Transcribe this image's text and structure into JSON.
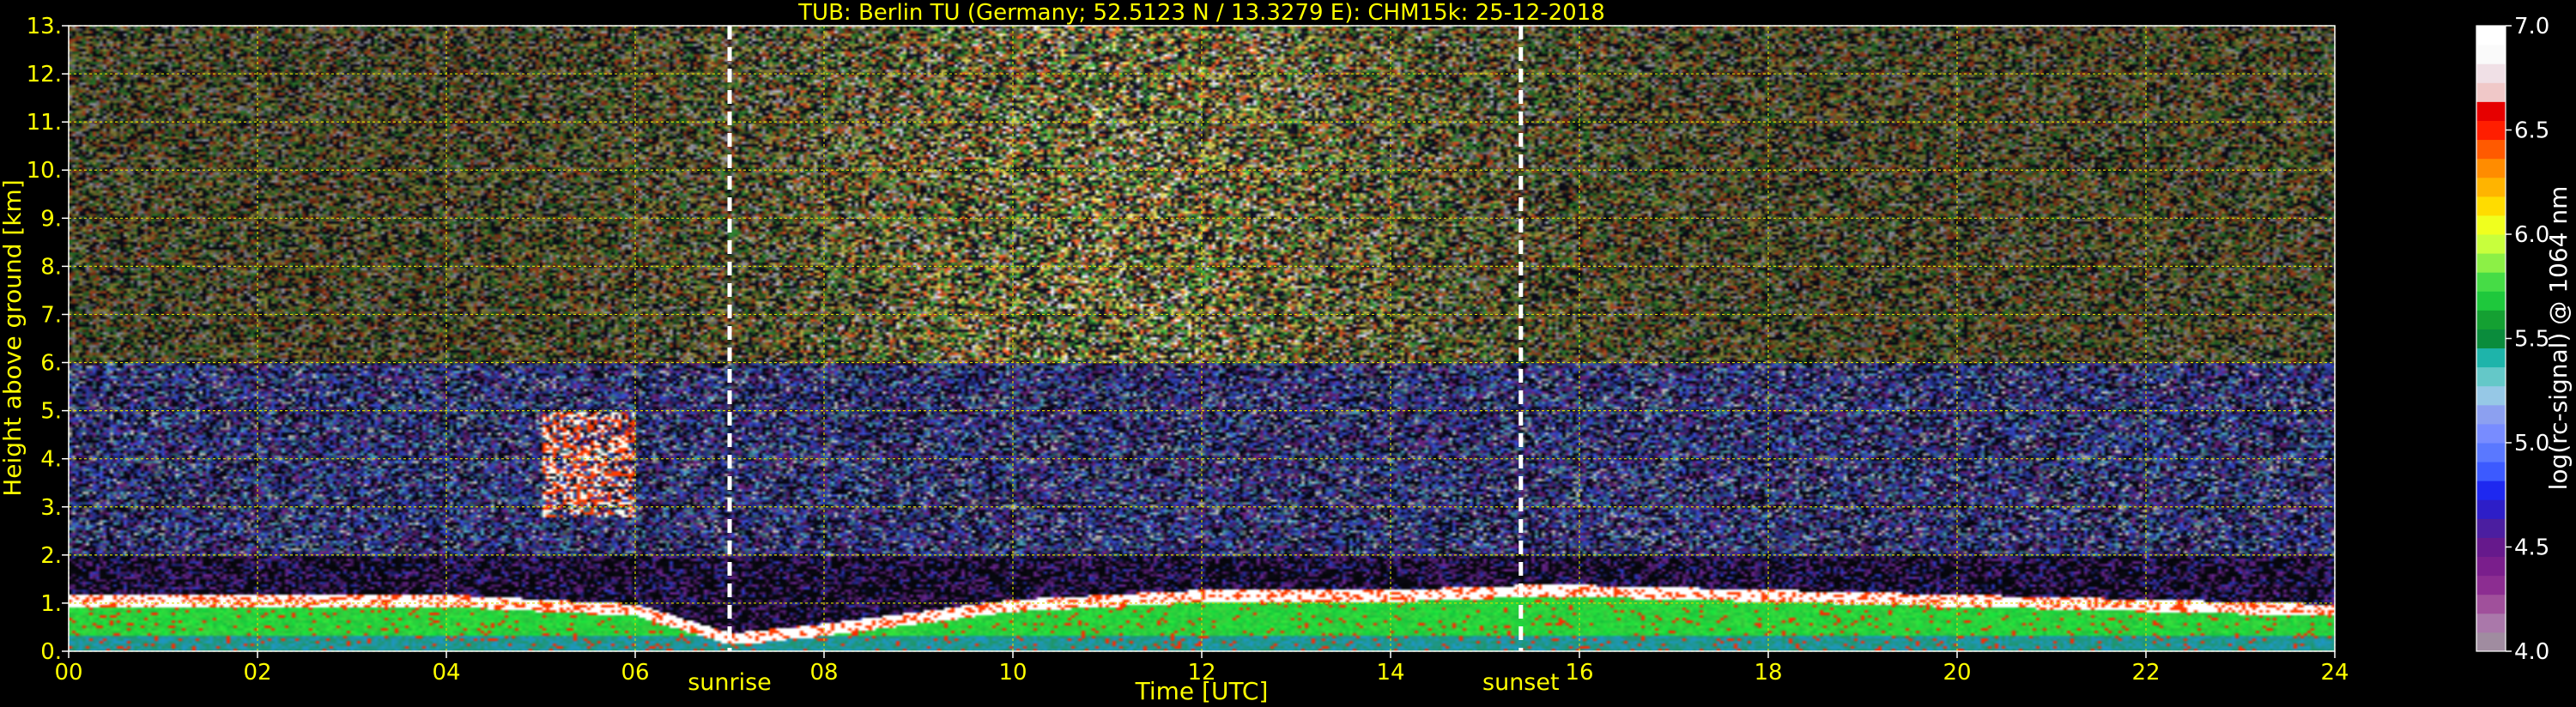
{
  "chart_data": [
    {
      "type": "heatmap",
      "title": "TUB: Berlin TU (Germany; 52.5123 N / 13.3279 E):    CHM15k: 25-12-2018",
      "xlabel": "Time [UTC]",
      "ylabel": "Height above ground [km]",
      "xlim": [
        0,
        24
      ],
      "ylim": [
        0,
        13
      ],
      "x_ticks": [
        "00",
        "02",
        "04",
        "06",
        "08",
        "10",
        "12",
        "14",
        "16",
        "18",
        "20",
        "22",
        "24"
      ],
      "y_ticks": [
        "0.",
        "1.",
        "2.",
        "3.",
        "4.",
        "5.",
        "6.",
        "7.",
        "8.",
        "9.",
        "10.",
        "11.",
        "12.",
        "13."
      ],
      "grid": true,
      "annotations": [
        {
          "label": "sunrise",
          "x": 7.0
        },
        {
          "label": "sunset",
          "x": 15.38
        }
      ],
      "layers": [
        {
          "feature": "boundary layer top",
          "x": [
            0,
            2,
            4,
            5,
            6,
            7,
            8,
            10,
            12,
            14,
            15.4,
            16,
            18,
            20,
            22,
            24
          ],
          "y": [
            1.1,
            1.1,
            1.1,
            1.0,
            0.9,
            0.3,
            0.5,
            1.0,
            1.2,
            1.2,
            1.3,
            1.3,
            1.2,
            1.1,
            1.0,
            0.9
          ]
        },
        {
          "feature": "elevated aerosol/cloud",
          "x": [
            5.0,
            6.0
          ],
          "y": [
            2.8,
            5.0
          ]
        }
      ]
    },
    {
      "type": "colorbar",
      "label": "log(rc-signal) @ 1064 nm",
      "range": [
        4.0,
        7.0
      ],
      "ticks": [
        "4.0",
        "4.5",
        "5.0",
        "5.5",
        "6.0",
        "6.5",
        "7.0"
      ],
      "colors": [
        "#a08ca0",
        "#aa78aa",
        "#a0509b",
        "#8c2d91",
        "#7a1e8c",
        "#66198c",
        "#4b1ea0",
        "#2d1ec8",
        "#1e28f0",
        "#3c5aff",
        "#5a78ff",
        "#788cff",
        "#8ca0f0",
        "#96c8e6",
        "#64c8c8",
        "#1eb4aa",
        "#0a8c3c",
        "#14a032",
        "#1ec83c",
        "#46dc46",
        "#8cf046",
        "#c8ff3c",
        "#f0ff1e",
        "#ffdc00",
        "#ffb400",
        "#ff8c00",
        "#ff5a00",
        "#ff1e00",
        "#e60000",
        "#f0c8c8",
        "#f0e0e6",
        "#fafafa",
        "#ffffff"
      ]
    }
  ]
}
